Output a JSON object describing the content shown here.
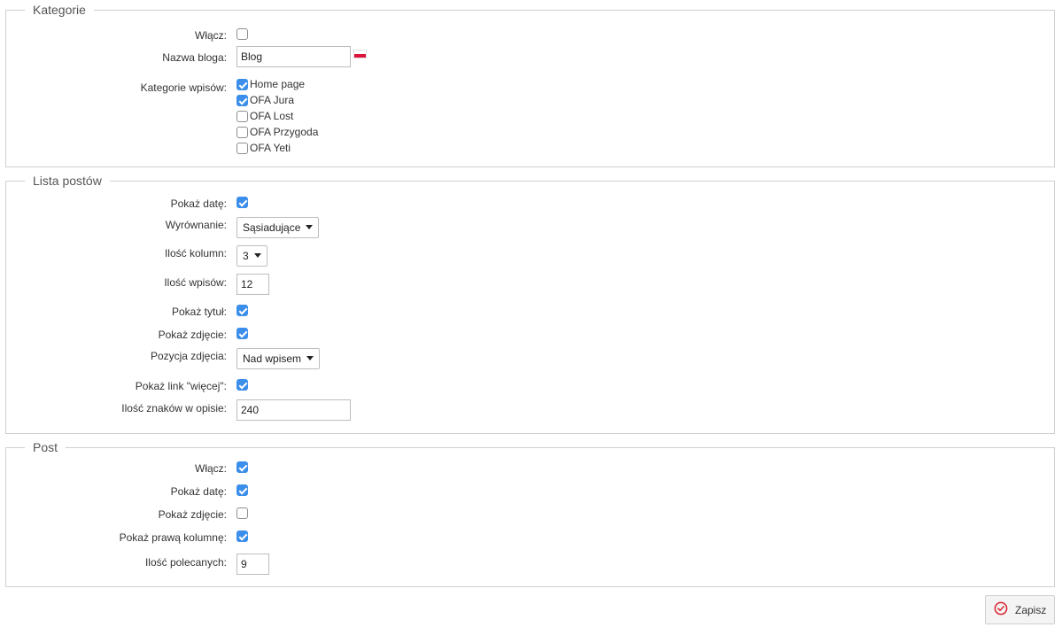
{
  "kategorie": {
    "title": "Kategorie",
    "wlacz": {
      "label": "Włącz:",
      "checked": false
    },
    "nazwa_bloga": {
      "label": "Nazwa bloga:",
      "value": "Blog",
      "language_flag": "pl-flag-icon"
    },
    "kategorie_wpisow": {
      "label": "Kategorie wpisów:",
      "items": [
        {
          "label": "Home page",
          "checked": true
        },
        {
          "label": "OFA Jura",
          "checked": true
        },
        {
          "label": "OFA Lost",
          "checked": false
        },
        {
          "label": "OFA Przygoda",
          "checked": false
        },
        {
          "label": "OFA Yeti",
          "checked": false
        }
      ]
    }
  },
  "lista_postow": {
    "title": "Lista postów",
    "pokaz_date": {
      "label": "Pokaż datę:",
      "checked": true
    },
    "wyrownanie": {
      "label": "Wyrównanie:",
      "value": "Sąsiadujące"
    },
    "ilosc_kolumn": {
      "label": "Ilość kolumn:",
      "value": "3"
    },
    "ilosc_wpisow": {
      "label": "Ilość wpisów:",
      "value": "12"
    },
    "pokaz_tytul": {
      "label": "Pokaż tytuł:",
      "checked": true
    },
    "pokaz_zdjecie": {
      "label": "Pokaż zdjęcie:",
      "checked": true
    },
    "pozycja_zdjecia": {
      "label": "Pozycja zdjęcia:",
      "value": "Nad wpisem"
    },
    "pokaz_link": {
      "label": "Pokaż link \"więcej\":",
      "checked": true
    },
    "ilosc_znakow": {
      "label": "Ilość znaków w opisie:",
      "value": "240"
    }
  },
  "post": {
    "title": "Post",
    "wlacz": {
      "label": "Włącz:",
      "checked": true
    },
    "pokaz_date": {
      "label": "Pokaż datę:",
      "checked": true
    },
    "pokaz_zdjecie": {
      "label": "Pokaż zdjęcie:",
      "checked": false
    },
    "pokaz_prawa_kolumne": {
      "label": "Pokaż prawą kolumnę:",
      "checked": true
    },
    "ilosc_polecanych": {
      "label": "Ilość polecanych:",
      "value": "9"
    }
  },
  "save_button": {
    "label": "Zapisz",
    "icon": "check-circle-icon",
    "icon_color": "#d9232e"
  },
  "colors": {
    "checkbox_checked": "#3b8eea",
    "border": "#cfcfcf"
  }
}
